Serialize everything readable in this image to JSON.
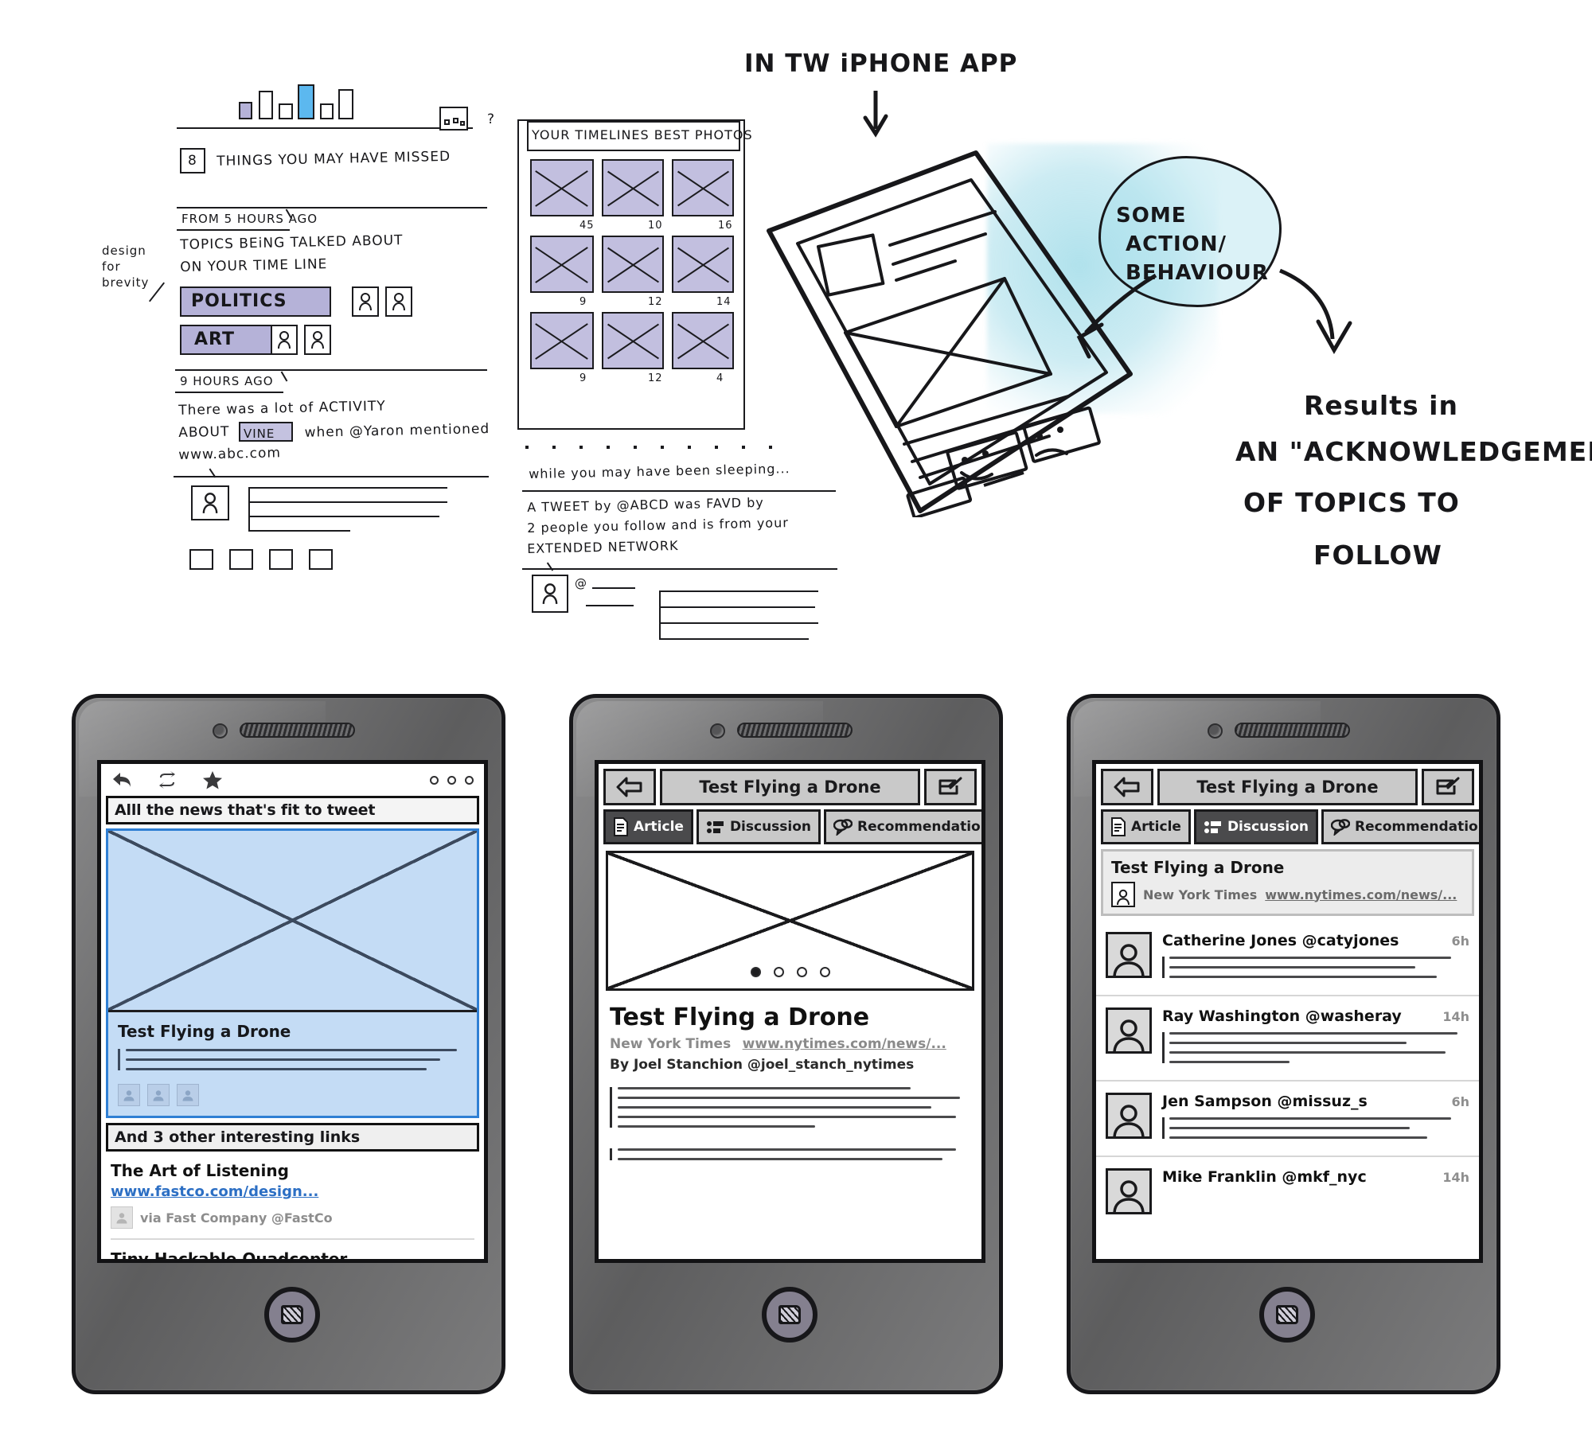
{
  "sketch": {
    "headline_note": "IN TW iPHONE APP",
    "panel1": {
      "summary_count": "8",
      "summary_label": "THINGS YOU MAY HAVE MISSED",
      "time_1": "FROM 5 HOURS AGO",
      "body_1_line1": "TOPICS BEiNG TALKED ABOUT",
      "body_1_line2": "ON YOUR TIME LINE",
      "topics": [
        "POLITICS",
        "ART"
      ],
      "time_2": "9 HOURS AGO",
      "body_2_line1": "There was a lot of ACTIVITY",
      "body_2_line2_pre": "ABOUT ",
      "body_2_highlight": "VINE",
      "body_2_line2_post": " when @Yaron mentioned",
      "body_2_line3": "www.abc.com",
      "margin_note_line1": "design",
      "margin_note_line2": "for",
      "margin_note_line3": "brevity"
    },
    "panel2": {
      "title": "YOUR TIMELINES BEST PHOTOS",
      "grid_counts": [
        "45",
        "10",
        "16",
        "9",
        "12",
        "14",
        "9",
        "12",
        "4"
      ],
      "sleeping_line": "while you may have been sleeping...",
      "tweet_line1": "A TWEET by @ABCD was FAVD by",
      "tweet_line2": "2 people you follow and is from your",
      "tweet_line3": "EXTENDED NETWORK",
      "handle_stub": "@"
    },
    "panel3": {
      "bubble_line1": "SOME",
      "bubble_line2": "ACTION/",
      "bubble_line3": "BEHAVIOUR",
      "result_line1": "Results in",
      "result_line2": "AN \"ACKNOWLEDGEMENT\"",
      "result_line3": "OF TOPICS TO",
      "result_line4": "FOLLOW"
    }
  },
  "phone1": {
    "toolbar_icons": [
      "reply-icon",
      "retweet-icon",
      "star-icon",
      "more-icon"
    ],
    "header": "Alll the news that's fit to tweet",
    "hero_title": "Test Flying a Drone",
    "divider_band": "And 3 other interesting links",
    "links": [
      {
        "title": "The Art of Listening",
        "url": "www.fastco.com/design...",
        "via": "via Fast Company @FastCo"
      },
      {
        "title": "Tiny Hackable Quadcopter",
        "url": "",
        "via": ""
      }
    ]
  },
  "phone2": {
    "nav_title": "Test Flying a Drone",
    "back_icon": "back-arrow-icon",
    "compose_icon": "compose-icon",
    "tabs": [
      {
        "label": "Article",
        "icon": "document-icon",
        "active": true
      },
      {
        "label": "Discussion",
        "icon": "discussion-icon",
        "active": false
      },
      {
        "label": "Recommendations",
        "icon": "speech-bubbles-icon",
        "active": false
      }
    ],
    "pager_count": 4,
    "pager_active": 1,
    "article_title": "Test Flying a Drone",
    "source": "New York Times",
    "source_url": "www.nytimes.com/news/...",
    "byline": "By Joel Stanchion @joel_stanch_nytimes"
  },
  "phone3": {
    "nav_title": "Test Flying a Drone",
    "back_icon": "back-arrow-icon",
    "compose_icon": "compose-icon",
    "tabs": [
      {
        "label": "Article",
        "icon": "document-icon",
        "active": false
      },
      {
        "label": "Discussion",
        "icon": "discussion-icon",
        "active": true
      },
      {
        "label": "Recommendations",
        "icon": "speech-bubbles-icon",
        "active": false
      }
    ],
    "source_card": {
      "title": "Test Flying a Drone",
      "source": "New York Times",
      "url": "www.nytimes.com/news/..."
    },
    "comments": [
      {
        "name": "Catherine Jones @catyjones",
        "time": "6h",
        "lines": 3
      },
      {
        "name": "Ray Washington @washeray",
        "time": "14h",
        "lines": 4
      },
      {
        "name": "Jen Sampson @missuz_s",
        "time": "6h",
        "lines": 3
      },
      {
        "name": "Mike Franklin @mkf_nyc",
        "time": "14h",
        "lines": 1
      }
    ]
  },
  "colors": {
    "sketch_ink": "#17171a",
    "sketch_violet": "#b5b2d8",
    "sketch_blue_highlight": "#5cb8ef",
    "watercolor": "#96d8e6",
    "phone_body": "#6f6f70",
    "hero_blue": "#c4dcf5",
    "hero_border": "#2f7fd4",
    "link_blue": "#2c6fc4",
    "tab_active": "#4a4a4c"
  }
}
